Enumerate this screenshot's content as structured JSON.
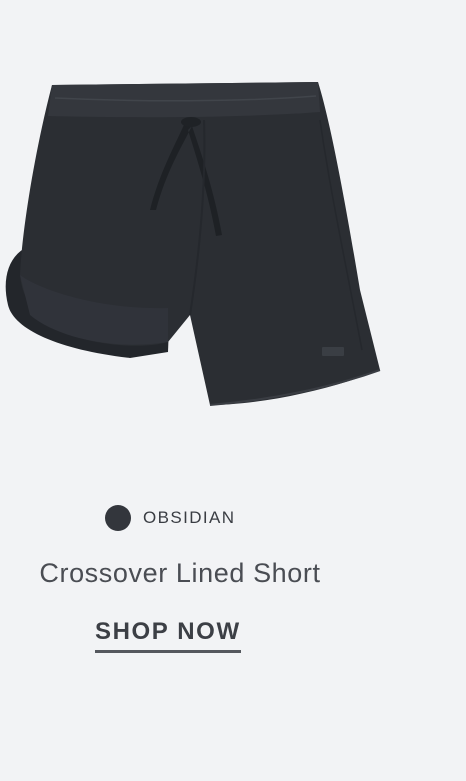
{
  "product": {
    "image_alt": "Crossover Lined Short in Obsidian",
    "color": {
      "name": "OBSIDIAN",
      "swatch_hex": "#33363c"
    },
    "title": "Crossover Lined Short",
    "cta_label": "SHOP NOW"
  },
  "colors": {
    "background": "#f2f3f5",
    "text": "#4a4d53",
    "garment": "#2b2e33"
  }
}
